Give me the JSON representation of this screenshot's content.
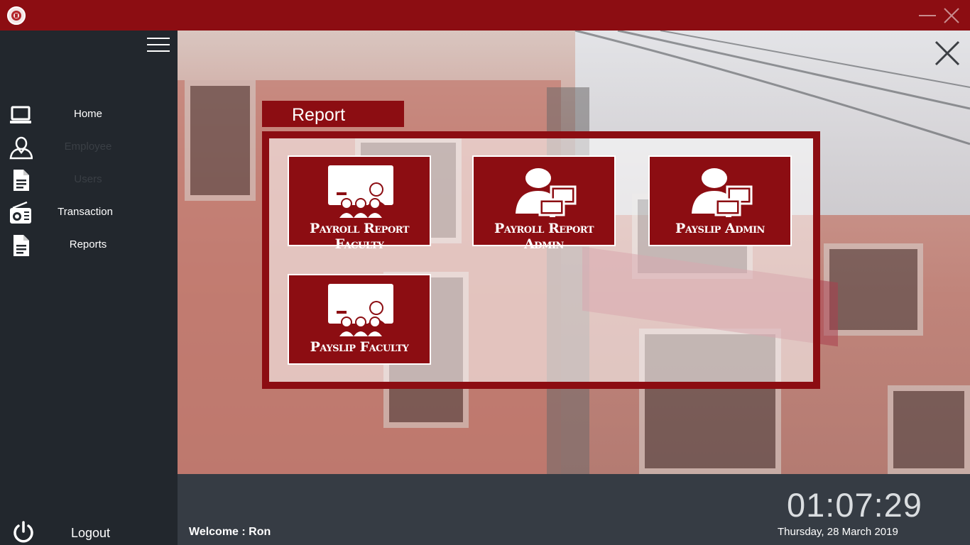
{
  "app": {
    "brand_color": "#8c0d12",
    "window_controls": {
      "minimize_icon": "minimize-icon",
      "close_icon": "close-icon"
    }
  },
  "sidebar": {
    "menu_icon": "hamburger-icon",
    "items": [
      {
        "label": "Home",
        "icon": "laptop-icon",
        "state": "active"
      },
      {
        "label": "Employee",
        "icon": "user-icon",
        "state": "dim"
      },
      {
        "label": "Users",
        "icon": "document-icon",
        "state": "dim"
      },
      {
        "label": "Transaction",
        "icon": "radio-icon",
        "state": "active"
      },
      {
        "label": "Reports",
        "icon": "document-icon",
        "state": "active"
      }
    ],
    "logout": {
      "label": "Logout",
      "icon": "power-icon"
    }
  },
  "main": {
    "close_icon": "close-icon",
    "section_title": "Report",
    "tiles": [
      {
        "label": "Payroll Report Faculty",
        "icon": "presentation-group-icon"
      },
      {
        "label": "Payroll Report Admin",
        "icon": "admin-computer-icon"
      },
      {
        "label": "Payslip Admin",
        "icon": "admin-computer-icon"
      },
      {
        "label": "Payslip Faculty",
        "icon": "presentation-group-icon"
      }
    ]
  },
  "footer": {
    "welcome": "Welcome : Ron",
    "time": "01:07:29",
    "date": "Thursday, 28 March 2019"
  }
}
